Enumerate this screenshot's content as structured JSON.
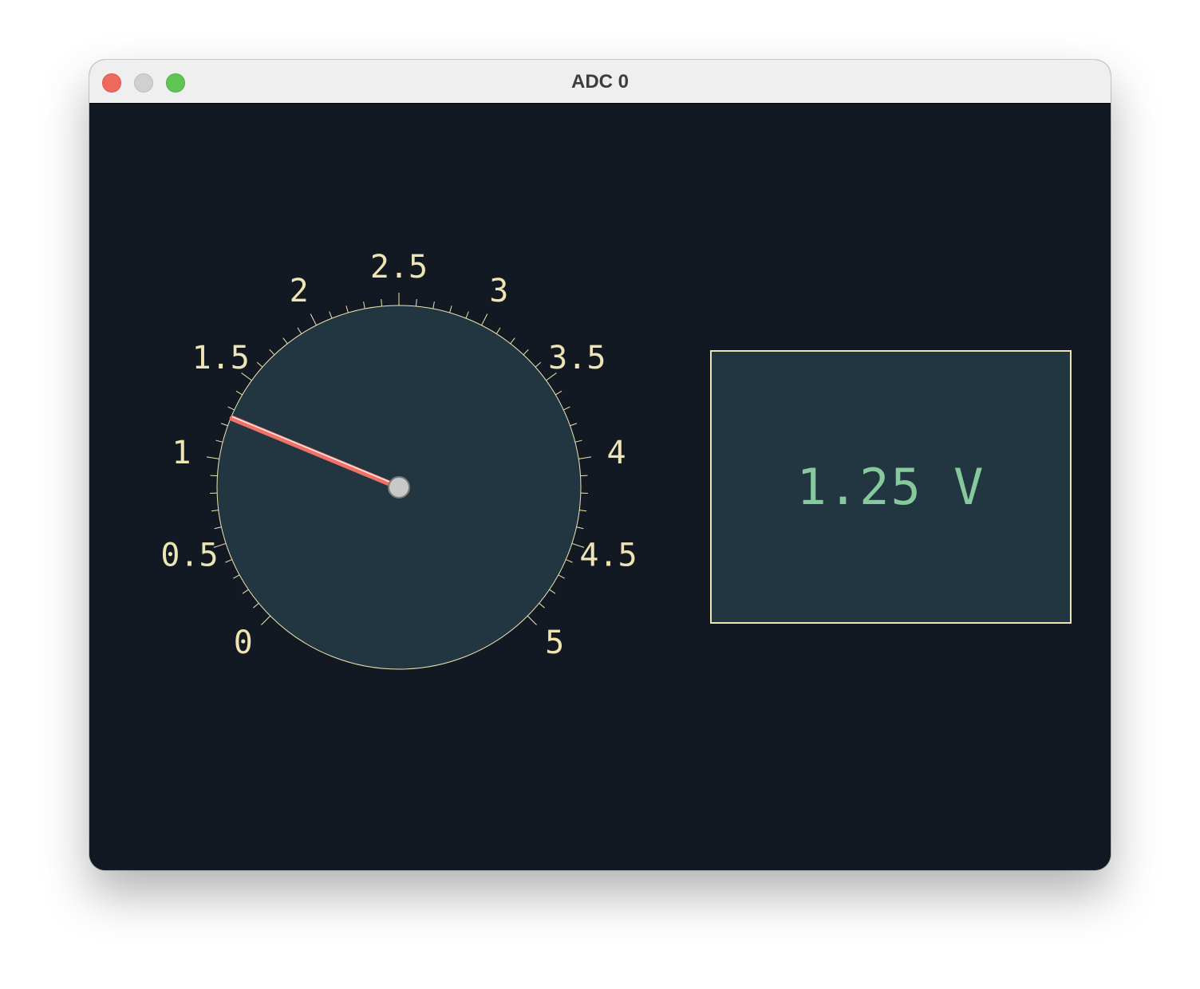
{
  "window": {
    "title": "ADC 0"
  },
  "gauge": {
    "value": 1.25,
    "min": 0,
    "max": 5,
    "major_step": 0.5,
    "minor_per_major": 5,
    "tick_labels": [
      "0",
      "0.5",
      "1",
      "1.5",
      "2",
      "2.5",
      "3",
      "3.5",
      "4",
      "4.5",
      "5"
    ]
  },
  "readout": {
    "value": "1.25",
    "unit": "V",
    "text": "1.25 V"
  },
  "colors": {
    "background": "#131922",
    "dial_face": "#213640",
    "accent_cream": "#eee5b4",
    "needle": "#f07167",
    "readout_text": "#86c99c",
    "hub": "#c8c8c8"
  }
}
